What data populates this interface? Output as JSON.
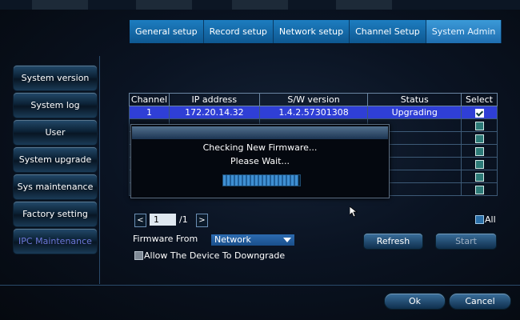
{
  "tabs": [
    "General setup",
    "Record setup",
    "Network setup",
    "Channel Setup",
    "System Admin"
  ],
  "active_tab": "System Admin",
  "sidebar": [
    "System version",
    "System log",
    "User",
    "System upgrade",
    "Sys maintenance",
    "Factory setting",
    "IPC Maintenance"
  ],
  "active_sidebar": "IPC Maintenance",
  "table": {
    "headers": [
      "Channel",
      "IP address",
      "S/W version",
      "Status",
      "Select"
    ],
    "rows": [
      {
        "channel": "1",
        "ip": "172.20.14.32",
        "version": "1.4.2.57301308",
        "status": "Upgrading",
        "selected": true
      }
    ],
    "row_count": 7
  },
  "dialog": {
    "message1": "Checking New Firmware...",
    "message2": "Please Wait...",
    "progress": 0.98
  },
  "pager": {
    "prev": "<",
    "page": "1",
    "total": "/1",
    "next": ">"
  },
  "all_label": "All",
  "firmware_from_label": "Firmware From",
  "firmware_from_value": "Network",
  "refresh_label": "Refresh",
  "start_label": "Start",
  "allow_downgrade_label": "Allow The Device To Downgrade",
  "ok_label": "Ok",
  "cancel_label": "Cancel",
  "colors": {
    "accent": "#1d7dc0",
    "selected_row": "#2f3fd6",
    "active_sidebar_text": "#6d78d9"
  }
}
